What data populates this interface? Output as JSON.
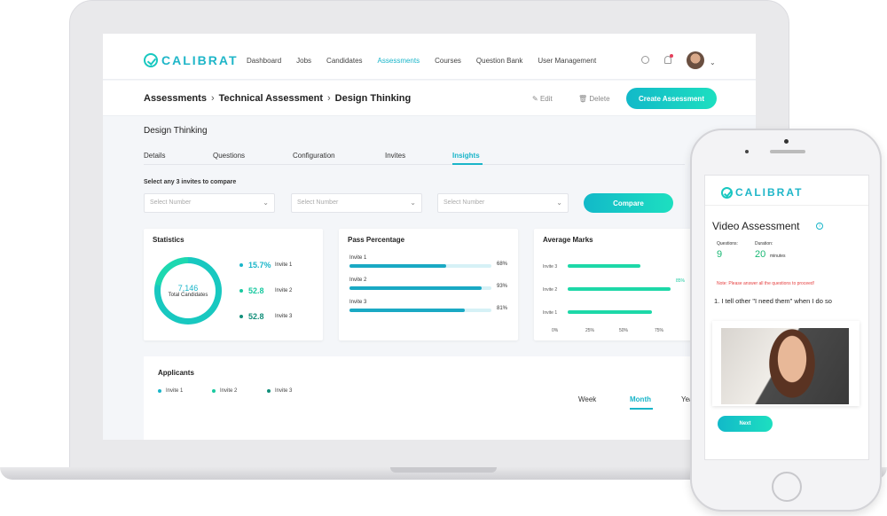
{
  "laptop": {
    "brand": "CALIBRAT",
    "nav": [
      "Dashboard",
      "Jobs",
      "Candidates",
      "Assessments",
      "Courses",
      "Question Bank",
      "User Management"
    ],
    "breadcrumb": [
      "Assessments",
      "Technical Assessment",
      "Design Thinking"
    ],
    "actions": {
      "edit": "Edit",
      "delete": "Delete",
      "create": "Create Assessment"
    },
    "page_title": "Design Thinking",
    "tabs": [
      "Details",
      "Questions",
      "Configuration",
      "Invites",
      "Insights"
    ],
    "compare_label": "Select any 3 invites to compare",
    "select_placeholder": "Select Number",
    "compare_button": "Compare",
    "statistics": {
      "title": "Statistics",
      "total_value": "7,146",
      "total_label": "Total Candidates",
      "rows": [
        {
          "value": "15.7%",
          "label": "Invite 1",
          "color": "#19b5c9"
        },
        {
          "value": "52.8",
          "label": "Invite 2",
          "color": "#19c9a0"
        },
        {
          "value": "52.8",
          "label": "Invite 3",
          "color": "#128f7a"
        }
      ]
    },
    "pass_percentage": {
      "title": "Pass Percentage",
      "rows": [
        {
          "label": "Invite 1",
          "value": "68%",
          "fraction": 0.68
        },
        {
          "label": "Invite 2",
          "value": "93%",
          "fraction": 0.93
        },
        {
          "label": "Invite 3",
          "value": "81%",
          "fraction": 0.81
        }
      ]
    },
    "average_marks": {
      "title": "Average Marks",
      "rows": [
        {
          "label": "Invite 3",
          "fraction": 0.6
        },
        {
          "label": "Invite 2",
          "fraction": 0.85,
          "value": "85%"
        },
        {
          "label": "Invite 1",
          "fraction": 0.7
        }
      ],
      "ticks": [
        "0%",
        "25%",
        "50%",
        "75%"
      ]
    },
    "applicants": {
      "title": "Applicants",
      "legend": [
        {
          "label": "Invite 1",
          "color": "#19b5c9"
        },
        {
          "label": "Invite 2",
          "color": "#19c9a0"
        },
        {
          "label": "Invite 3",
          "color": "#128f7a"
        }
      ],
      "periods": [
        "Week",
        "Month",
        "Yea"
      ]
    }
  },
  "phone": {
    "brand": "CALIBRAT",
    "title": "Video Assessment",
    "info_glyph": "i",
    "questions_label": "Questions:",
    "questions_value": "9",
    "duration_label": "Duration:",
    "duration_value": "20",
    "duration_unit": "minutes",
    "note": "Note: Please answer all the questions to proceed!",
    "question": "1. I tell other \"I need them\" when I do so",
    "next_button": "Next"
  }
}
